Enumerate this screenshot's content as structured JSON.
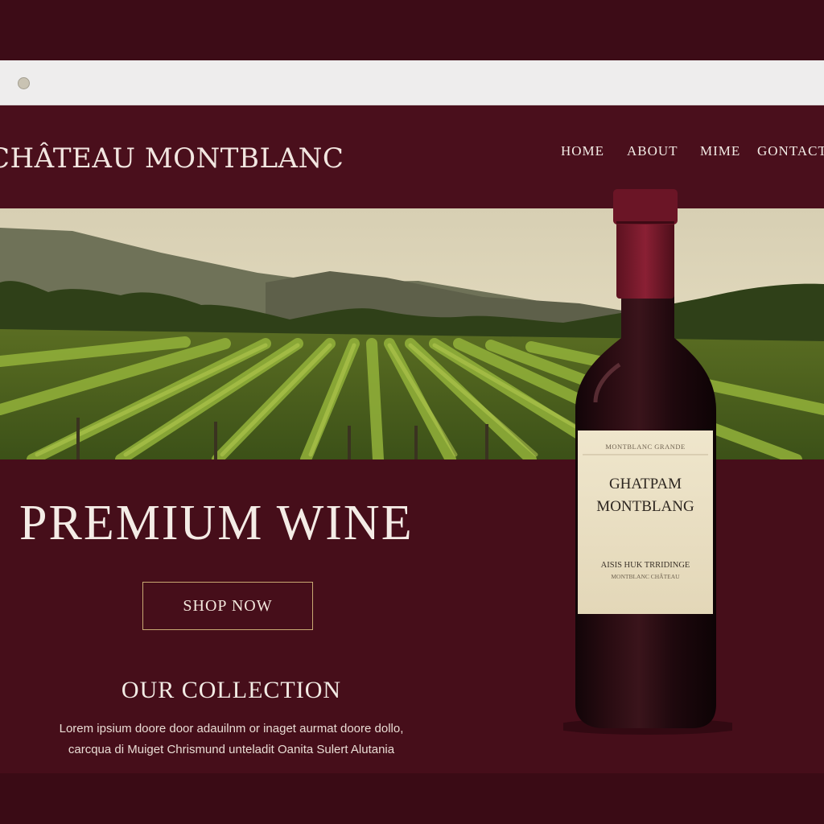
{
  "header": {
    "logo": "CHÂTEAU MONTBLANC",
    "nav": [
      "HOME",
      "ABOUT",
      "MIME",
      "GONTACT"
    ]
  },
  "hero": {
    "headline": "PREMIUM WINE",
    "cta": "SHOP NOW"
  },
  "collection": {
    "title": "OUR COLLECTION",
    "text_line1": "Lorem ipsium doore door adauilnm or inaget aurmat doore dollo,",
    "text_line2": "carcqua di Muiget Chrismund unteladit Oanita Sulert Alutania"
  },
  "bottle_label": {
    "top_line": "MONTBLANC GRANDE",
    "name_line1": "GHATPAM",
    "name_line2": "MONTBLANG",
    "sub_line1": "AISIS HUK TRRIDINGE",
    "sub_line2": "MONTBLANC CHÂTEAU"
  },
  "colors": {
    "background": "#3d0c17",
    "header_bg": "#4a0f1c",
    "accent_gold": "#c8a872",
    "text_light": "#f2ebe4"
  }
}
